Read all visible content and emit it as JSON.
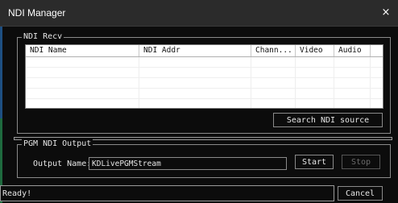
{
  "window": {
    "title": "NDI Manager",
    "close_glyph": "×"
  },
  "recv": {
    "legend": "NDI Recv",
    "columns": [
      "NDI Name",
      "NDI Addr",
      "Chann...",
      "Video",
      "Audio"
    ],
    "rows": [],
    "search_label": "Search NDI source"
  },
  "output": {
    "legend": "PGM NDI Output",
    "name_label": "Output Name:",
    "name_value": "KDLivePGMStream",
    "start_label": "Start",
    "stop_label": "Stop"
  },
  "status": {
    "text": "Ready!",
    "cancel_label": "Cancel"
  }
}
